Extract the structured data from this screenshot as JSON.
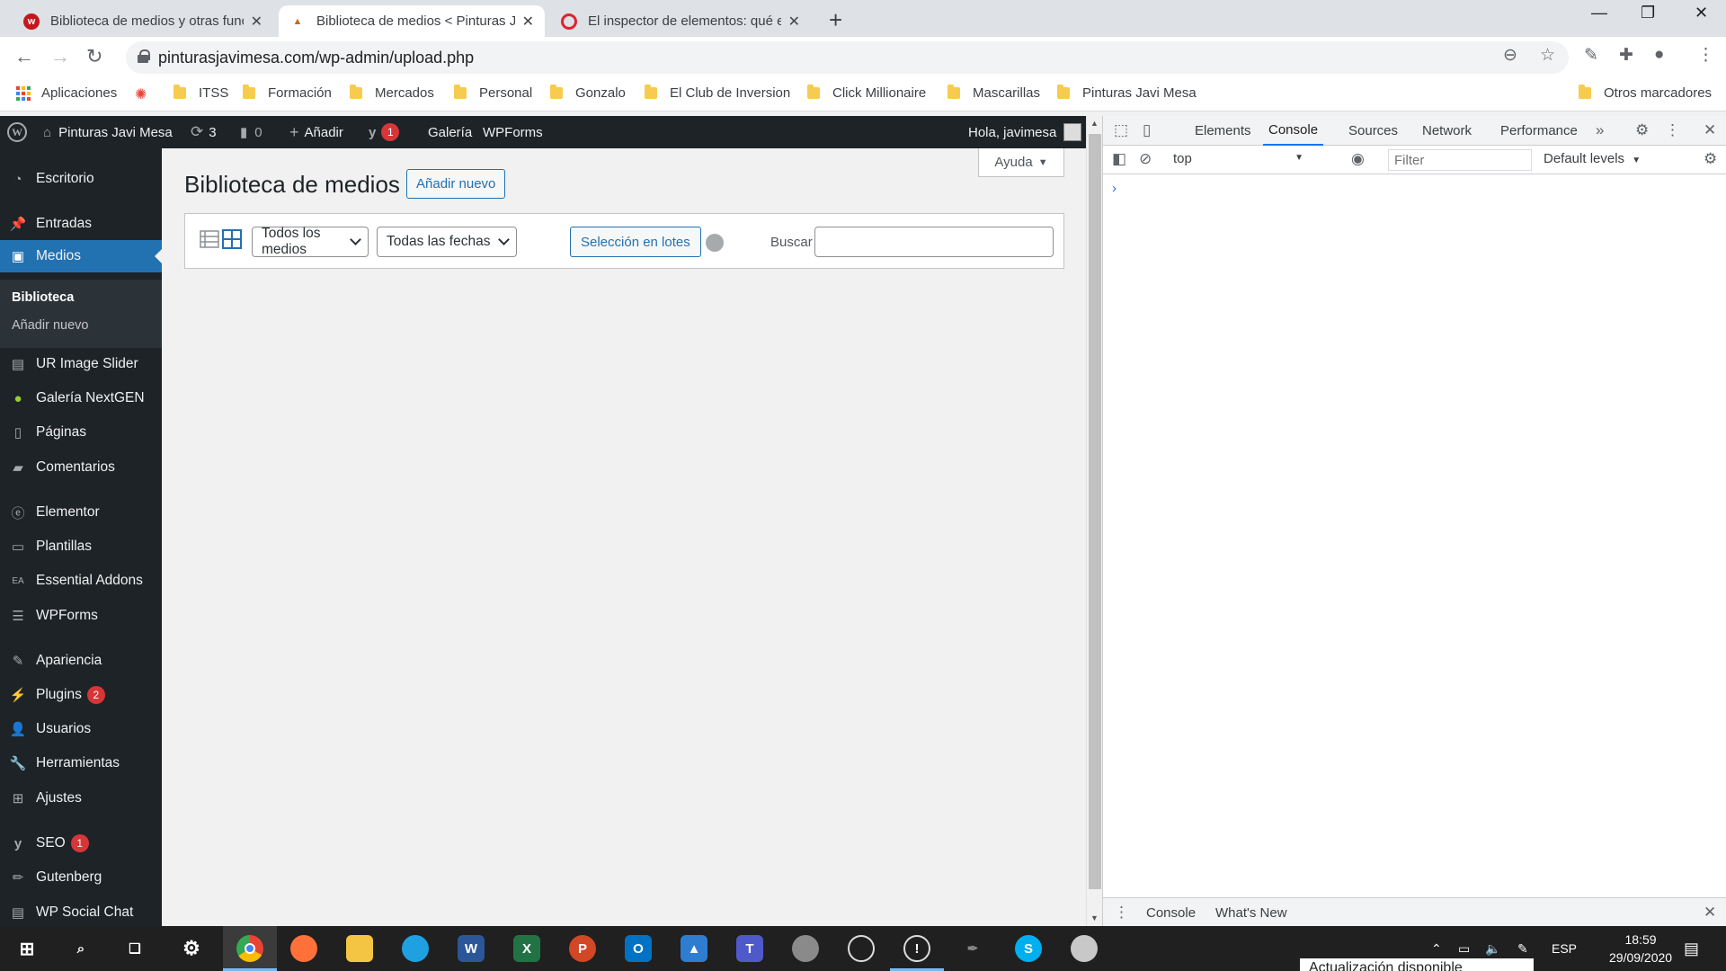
{
  "browser": {
    "tabs": [
      {
        "title": "Biblioteca de medios y otras func",
        "favicon": "red-circle-w-icon",
        "active": false
      },
      {
        "title": "Biblioteca de medios < Pinturas J",
        "favicon": "pinturas-favicon",
        "active": true
      },
      {
        "title": "El inspector de elementos: qué e",
        "favicon": "opera-icon",
        "active": false
      }
    ],
    "url": "pinturasjavimesa.com/wp-admin/upload.php",
    "bookmarks": [
      "Aplicaciones",
      "ITSS",
      "Formación",
      "Mercados",
      "Personal",
      "Gonzalo",
      "El Club de Inversion",
      "Click Millionaire",
      "Mascarillas",
      "Pinturas Javi Mesa"
    ],
    "other_bookmarks": "Otros marcadores"
  },
  "adminbar": {
    "site_name": "Pinturas Javi Mesa",
    "updates": "3",
    "comments": "0",
    "add": "Añadir",
    "yoast_badge": "1",
    "gallery": "Galería",
    "wpforms": "WPForms",
    "greeting": "Hola, javimesa"
  },
  "sidebar": {
    "items": [
      {
        "label": "Escritorio",
        "icon": "dashboard-icon"
      },
      {
        "label": "Entradas",
        "icon": "pin-icon"
      },
      {
        "label": "Medios",
        "icon": "media-icon"
      },
      {
        "label": "UR Image Slider",
        "icon": "slider-icon"
      },
      {
        "label": "Galería NextGEN",
        "icon": "nextgen-icon"
      },
      {
        "label": "Páginas",
        "icon": "page-icon"
      },
      {
        "label": "Comentarios",
        "icon": "comment-icon"
      },
      {
        "label": "Elementor",
        "icon": "elementor-icon"
      },
      {
        "label": "Plantillas",
        "icon": "folder-icon"
      },
      {
        "label": "Essential Addons",
        "icon": "ea-icon"
      },
      {
        "label": "WPForms",
        "icon": "form-icon"
      },
      {
        "label": "Apariencia",
        "icon": "brush-icon"
      },
      {
        "label": "Plugins",
        "icon": "plugin-icon",
        "badge": "2"
      },
      {
        "label": "Usuarios",
        "icon": "user-icon"
      },
      {
        "label": "Herramientas",
        "icon": "wrench-icon"
      },
      {
        "label": "Ajustes",
        "icon": "settings-icon"
      },
      {
        "label": "SEO",
        "icon": "yoast-icon",
        "badge": "1"
      },
      {
        "label": "Gutenberg",
        "icon": "pencil-icon"
      },
      {
        "label": "WP Social Chat",
        "icon": "chat-icon"
      }
    ],
    "submenu": [
      "Biblioteca",
      "Añadir nuevo"
    ]
  },
  "main": {
    "help": "Ayuda",
    "title": "Biblioteca de medios",
    "add_new": "Añadir nuevo",
    "filter_media": "Todos los medios",
    "filter_dates": "Todas las fechas",
    "bulk_select": "Selección en lotes",
    "search_label": "Buscar",
    "search_value": ""
  },
  "devtools": {
    "tabs": [
      "Elements",
      "Console",
      "Sources",
      "Network",
      "Performance"
    ],
    "active_tab": "Console",
    "context": "top",
    "filter_placeholder": "Filter",
    "levels": "Default levels",
    "drawer_tabs": [
      "Console",
      "What's New"
    ]
  },
  "taskbar": {
    "lang": "ESP",
    "time": "18:59",
    "date": "29/09/2020",
    "toast": "Actualización disponible"
  }
}
